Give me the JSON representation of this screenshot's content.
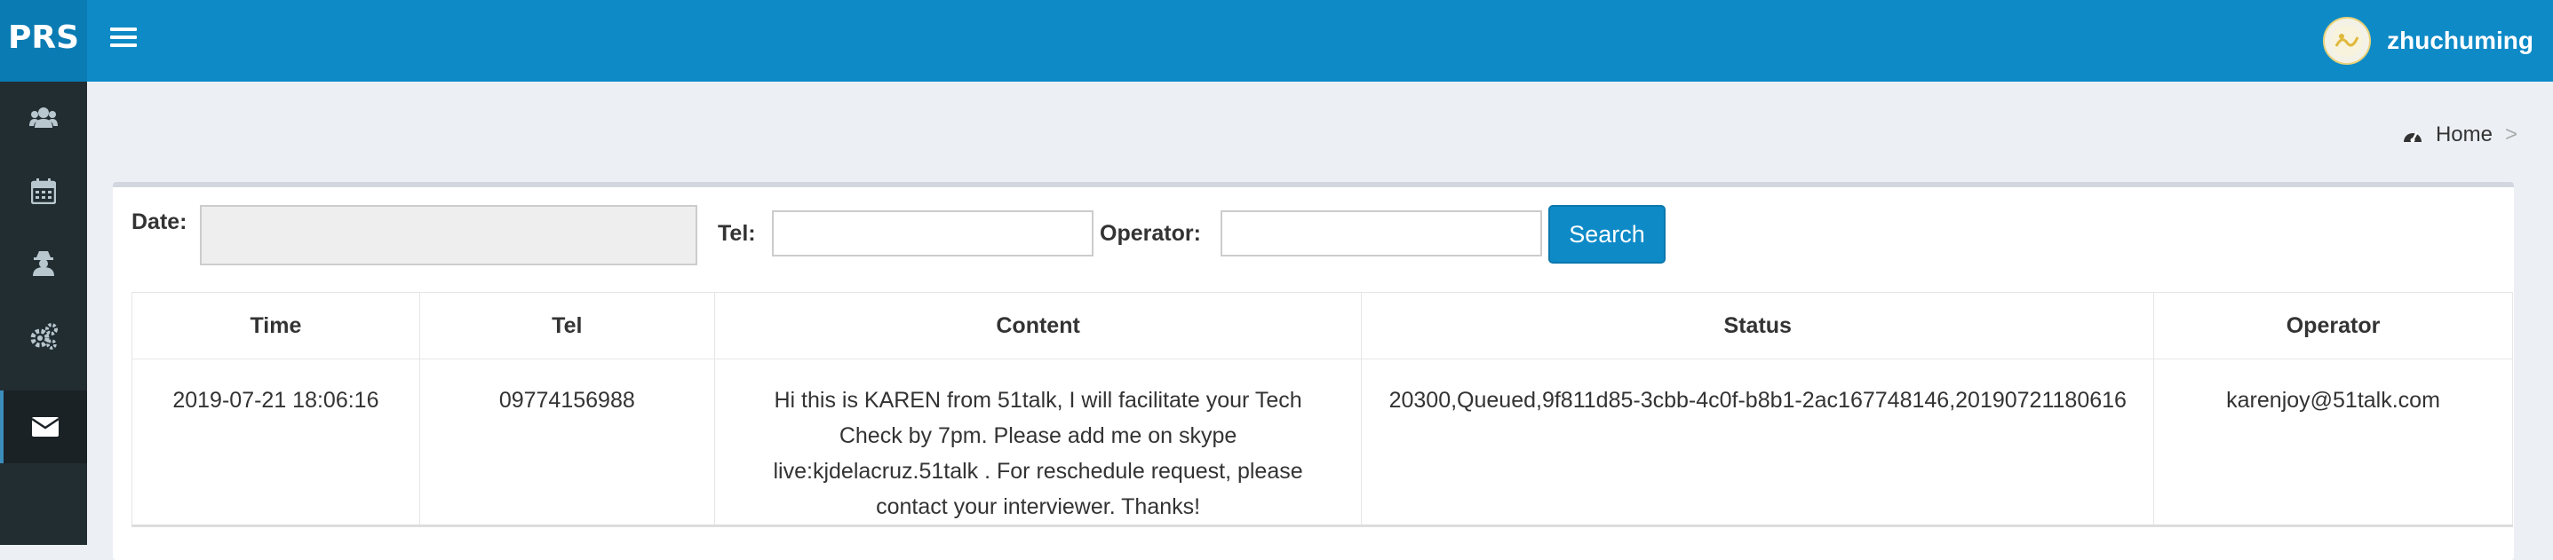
{
  "app": {
    "logo": "PRS"
  },
  "header": {
    "username": "zhuchuming"
  },
  "breadcrumb": {
    "home": "Home",
    "separator": ">"
  },
  "sidebar": {
    "items": [
      {
        "icon": "users-icon"
      },
      {
        "icon": "calendar-icon"
      },
      {
        "icon": "user-secret-icon"
      },
      {
        "icon": "gears-icon"
      },
      {
        "icon": "envelope-icon",
        "active": true
      }
    ]
  },
  "filters": {
    "date_label": "Date:",
    "tel_label": "Tel:",
    "operator_label": "Operator:",
    "date_value": "",
    "tel_value": "",
    "operator_value": "",
    "search_label": "Search"
  },
  "table": {
    "headers": [
      "Time",
      "Tel",
      "Content",
      "Status",
      "Operator"
    ],
    "rows": [
      {
        "time": "2019-07-21 18:06:16",
        "tel": "09774156988",
        "content": "Hi this is KAREN from 51talk, I will facilitate your Tech Check by 7pm. Please add me on skype live:kjdelacruz.51talk . For reschedule request, please contact your interviewer. Thanks!",
        "status": "20300,Queued,9f811d85-3cbb-4c0f-b8b1-2ac167748146,20190721180616",
        "operator": "karenjoy@51talk.com"
      }
    ]
  },
  "colors": {
    "header": "#0e8ac7",
    "sidebar": "#222d32",
    "background": "#ecf0f5",
    "button": "#0e8ac7"
  }
}
